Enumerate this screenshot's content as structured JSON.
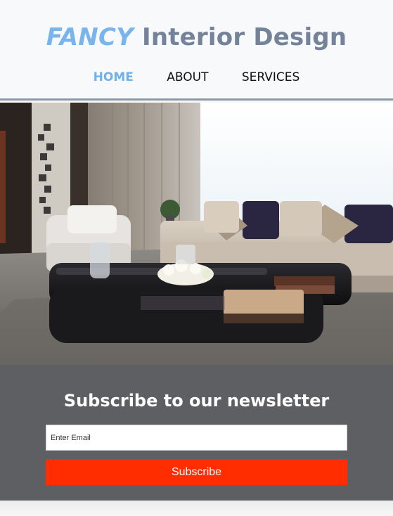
{
  "header": {
    "brand_accent": "FANCY",
    "brand_rest": "Interior Design",
    "nav": [
      {
        "label": "HOME",
        "active": true
      },
      {
        "label": "ABOUT",
        "active": false
      },
      {
        "label": "SERVICES",
        "active": false
      }
    ]
  },
  "hero": {
    "image": "living-room-photo"
  },
  "newsletter": {
    "title": "Subscribe to our newsletter",
    "email_placeholder": "Enter Email",
    "email_value": "",
    "button_label": "Subscribe"
  },
  "colors": {
    "accent": "#79b4ec",
    "brand_gray": "#74839a",
    "newsletter_bg": "#5e5f63",
    "button_red": "#ff2d00"
  }
}
